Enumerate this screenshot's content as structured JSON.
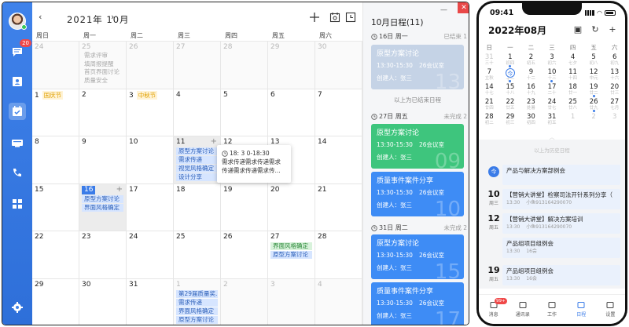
{
  "desktop": {
    "sidebar": {
      "message_badge": "20"
    },
    "toolbar": {
      "prev": "‹",
      "next": "›",
      "title": "2021年  10月"
    },
    "weekdays": [
      "周日",
      "周一",
      "周二",
      "周三",
      "周四",
      "周五",
      "周六"
    ],
    "cells": [
      {
        "d": "24",
        "other": true
      },
      {
        "d": "25",
        "other": true,
        "items": [
          "需求评审",
          "填周报提醒",
          "首页界面讨论",
          "质量安全"
        ]
      },
      {
        "d": "26",
        "other": true
      },
      {
        "d": "27",
        "other": true
      },
      {
        "d": "28",
        "other": true
      },
      {
        "d": "29",
        "other": true
      },
      {
        "d": "30",
        "other": true
      },
      {
        "d": "1",
        "holiday": "国庆节"
      },
      {
        "d": "2"
      },
      {
        "d": "3",
        "holiday": "中秋节"
      },
      {
        "d": "4"
      },
      {
        "d": "5"
      },
      {
        "d": "6"
      },
      {
        "d": "7"
      },
      {
        "d": "8"
      },
      {
        "d": "9"
      },
      {
        "d": "10"
      },
      {
        "d": "11",
        "hl": true,
        "plus": true,
        "events": [
          "原型方案讨论",
          "需求传递",
          "视觉风格确定",
          "设计分享"
        ]
      },
      {
        "d": "12"
      },
      {
        "d": "13"
      },
      {
        "d": "14"
      },
      {
        "d": "15"
      },
      {
        "d": "16",
        "hl": true,
        "today": true,
        "plus": true,
        "events": [
          "原型方案讨论",
          "界面风格确定"
        ]
      },
      {
        "d": "17"
      },
      {
        "d": "18"
      },
      {
        "d": "19"
      },
      {
        "d": "20"
      },
      {
        "d": "21"
      },
      {
        "d": "22"
      },
      {
        "d": "23"
      },
      {
        "d": "24"
      },
      {
        "d": "25"
      },
      {
        "d": "26"
      },
      {
        "d": "27",
        "events_green": [
          "界面风格确定"
        ],
        "events": [
          "原型方案讨论"
        ]
      },
      {
        "d": "28"
      },
      {
        "d": "29"
      },
      {
        "d": "30"
      },
      {
        "d": "31"
      },
      {
        "d": "1",
        "other": true,
        "events": [
          "第29届质量奖...",
          "需求传递",
          "界面风格确定",
          "原型方案讨论"
        ]
      },
      {
        "d": "2",
        "other": true
      },
      {
        "d": "3",
        "other": true
      },
      {
        "d": "4",
        "other": true
      }
    ],
    "popup": {
      "time": "18: 3 0-18:30",
      "line1": "需求传递需求传递需求",
      "line2": "传递需求传递需求传..."
    },
    "agenda": {
      "title": "10月日程(11)",
      "day1": {
        "label": "16日 周一",
        "status": "已结束 1"
      },
      "past_card": {
        "name": "原型方案讨论",
        "time": "13:30-15:30",
        "room": "26会议室",
        "creator": "创建人：张三",
        "big": "13"
      },
      "note": "以上为已结束日程",
      "day2": {
        "label": "27日 周五",
        "status": "未完成 2"
      },
      "card2": {
        "name": "原型方案讨论",
        "time": "13:30-15:30",
        "room": "26会议室",
        "creator": "创建人：张三",
        "big": "09"
      },
      "card3": {
        "name": "质量事件案件分享",
        "time": "13:30-15:30",
        "room": "26会议室",
        "creator": "创建人：张三",
        "big": "10"
      },
      "day3": {
        "label": "31日 周二",
        "status": "未完成 2"
      },
      "card4": {
        "name": "原型方案讨论",
        "time": "13:30-15:30",
        "room": "26会议室",
        "creator": "创建人：张三",
        "big": "15"
      },
      "card5": {
        "name": "质量事件案件分享",
        "time": "13:30-15:30",
        "room": "26会议室",
        "creator": "创建人：张三",
        "big": "17"
      }
    }
  },
  "phone": {
    "time": "09:41",
    "month": "2022年08月",
    "weekdays": [
      "日",
      "一",
      "二",
      "三",
      "四",
      "五",
      "六"
    ],
    "days": [
      {
        "d": "31",
        "l": "三十",
        "o": true
      },
      {
        "d": "1",
        "l": "初四",
        "dot": true
      },
      {
        "d": "2",
        "l": "初五"
      },
      {
        "d": "3",
        "l": "初六"
      },
      {
        "d": "4",
        "l": "七夕"
      },
      {
        "d": "5",
        "l": "初八"
      },
      {
        "d": "6",
        "l": "初九"
      },
      {
        "d": "7",
        "l": "立秋"
      },
      {
        "d": "今",
        "l": "十一",
        "sel": true,
        "dot": true
      },
      {
        "d": "9",
        "l": "十二"
      },
      {
        "d": "10",
        "l": "十三",
        "dot": true
      },
      {
        "d": "11",
        "l": "十四"
      },
      {
        "d": "12",
        "l": "中元"
      },
      {
        "d": "13",
        "l": "十六"
      },
      {
        "d": "14",
        "l": "十七"
      },
      {
        "d": "15",
        "l": "十八"
      },
      {
        "d": "16",
        "l": "十九"
      },
      {
        "d": "17",
        "l": "二十"
      },
      {
        "d": "18",
        "l": "廿一"
      },
      {
        "d": "19",
        "l": "廿二",
        "dot": true
      },
      {
        "d": "20",
        "l": "廿三"
      },
      {
        "d": "21",
        "l": "廿四"
      },
      {
        "d": "22",
        "l": "廿五"
      },
      {
        "d": "23",
        "l": "处暑"
      },
      {
        "d": "24",
        "l": "廿七"
      },
      {
        "d": "25",
        "l": "廿八"
      },
      {
        "d": "26",
        "l": "廿九",
        "dot": true
      },
      {
        "d": "27",
        "l": "七月"
      },
      {
        "d": "28",
        "l": "初二"
      },
      {
        "d": "29",
        "l": "初三"
      },
      {
        "d": "30",
        "l": "初四"
      },
      {
        "d": "31",
        "l": "初五"
      },
      {
        "d": "1",
        "l": "",
        "o": true
      },
      {
        "d": "2",
        "l": "",
        "o": true
      },
      {
        "d": "3",
        "l": "",
        "o": true
      }
    ],
    "note": "以上为历史日程",
    "events": [
      {
        "day": "今",
        "dw": "",
        "today": true,
        "name": "产品与解决方案部例会",
        "meta1": "",
        "meta2": ""
      },
      {
        "day": "10",
        "dw": "周三",
        "name": "【营销大讲堂】检察司法开针系列分享（",
        "meta1": "13:30",
        "meta2": "小鱼913164290070"
      },
      {
        "day": "12",
        "dw": "周五",
        "name": "【营销大讲堂】解决方案培训",
        "meta1": "13:30",
        "meta2": "小鱼913164290070"
      },
      {
        "day": "",
        "dw": "",
        "name": "产品组项目组例会",
        "meta1": "13:30",
        "meta2": "16会"
      },
      {
        "day": "19",
        "dw": "周五",
        "name": "产品组项目组例会",
        "meta1": "13:30",
        "meta2": "16会"
      }
    ],
    "tabs": [
      {
        "label": "消息",
        "badge": "99+"
      },
      {
        "label": "通讯录"
      },
      {
        "label": "工作"
      },
      {
        "label": "日程",
        "active": true
      },
      {
        "label": "设置"
      }
    ]
  }
}
